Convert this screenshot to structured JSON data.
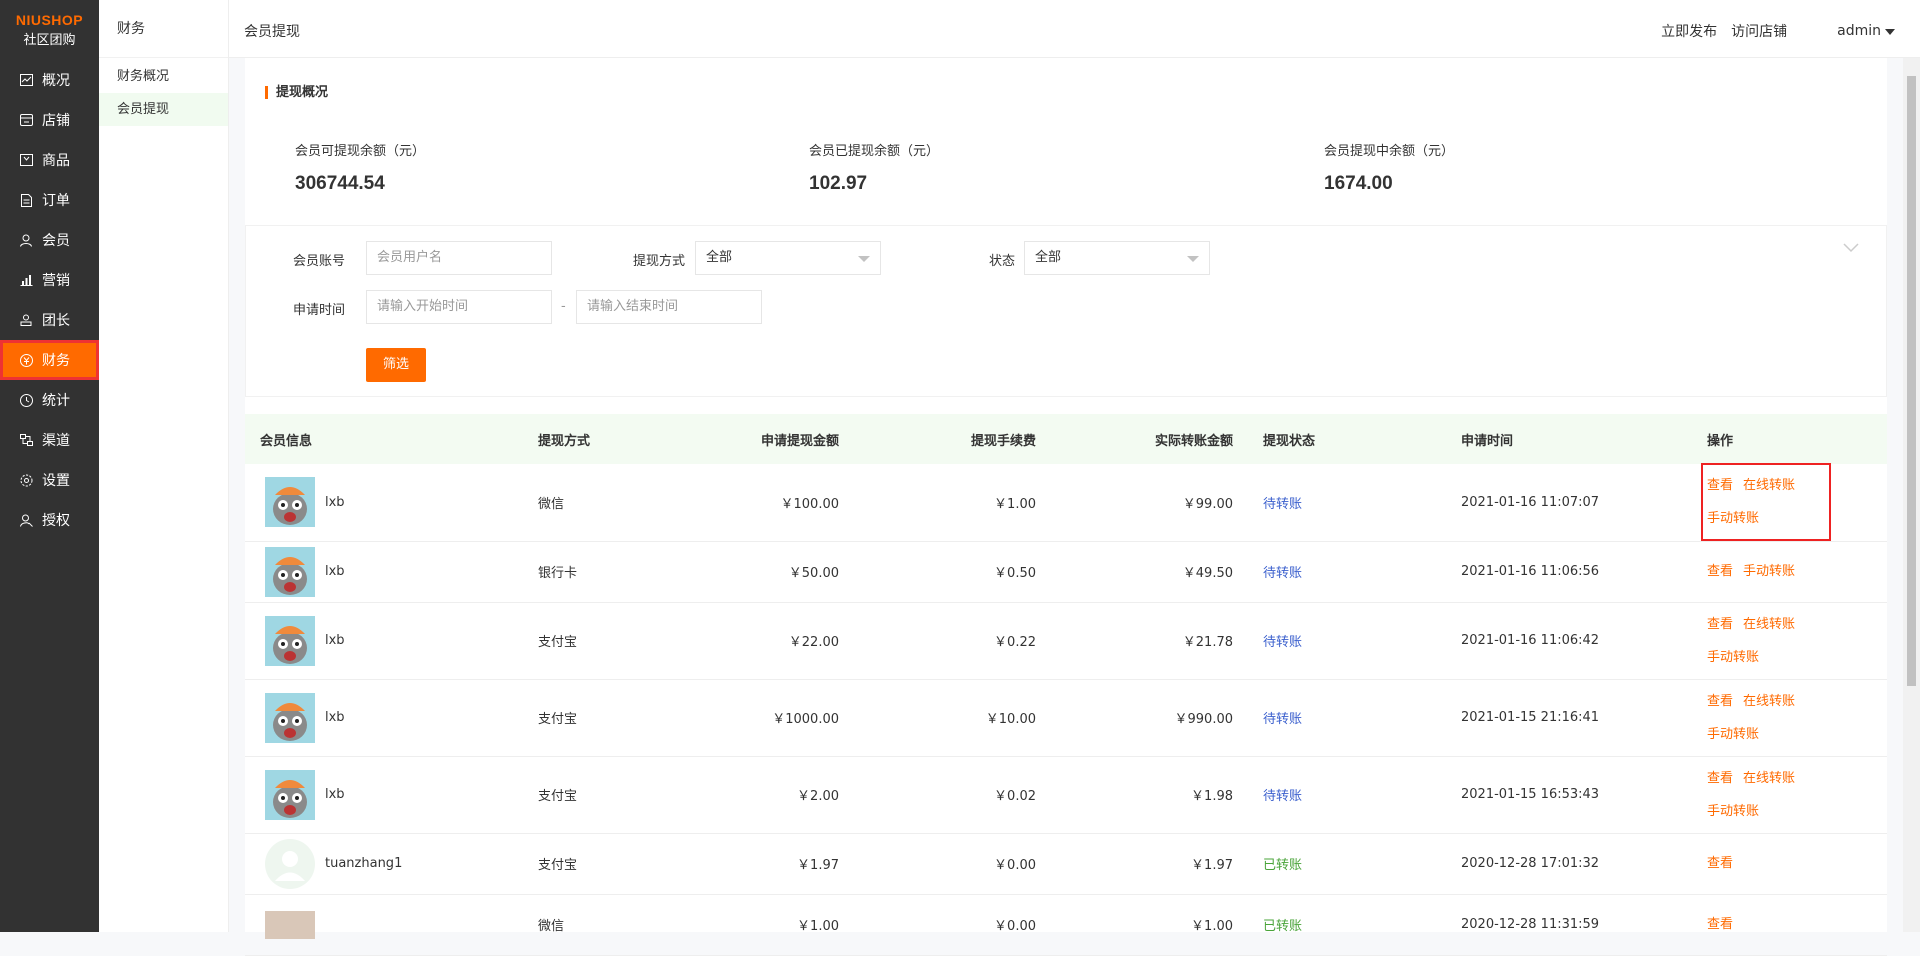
{
  "logo": {
    "line1": "NIUSHOP",
    "line2": "社区团购"
  },
  "sidebar": {
    "items": [
      {
        "label": "概况",
        "icon": "chart-icon"
      },
      {
        "label": "店铺",
        "icon": "store-icon"
      },
      {
        "label": "商品",
        "icon": "goods-icon"
      },
      {
        "label": "订单",
        "icon": "order-icon"
      },
      {
        "label": "会员",
        "icon": "user-icon"
      },
      {
        "label": "营销",
        "icon": "bar-chart-icon"
      },
      {
        "label": "团长",
        "icon": "leader-icon"
      },
      {
        "label": "财务",
        "icon": "yuan-icon"
      },
      {
        "label": "统计",
        "icon": "clock-icon"
      },
      {
        "label": "渠道",
        "icon": "channel-icon"
      },
      {
        "label": "设置",
        "icon": "gear-icon"
      },
      {
        "label": "授权",
        "icon": "key-user-icon"
      }
    ],
    "active": "财务"
  },
  "subside": {
    "title": "财务",
    "items": [
      "财务概况",
      "会员提现"
    ],
    "active": "会员提现"
  },
  "topbar": {
    "breadcrumb": "会员提现",
    "publish": "立即发布",
    "visit": "访问店铺",
    "user": "admin"
  },
  "overview": {
    "title": "提现概况",
    "stats": [
      {
        "label": "会员可提现余额（元）",
        "value": "306744.54"
      },
      {
        "label": "会员已提现余额（元）",
        "value": "102.97"
      },
      {
        "label": "会员提现中余额（元）",
        "value": "1674.00"
      }
    ]
  },
  "filter": {
    "account_label": "会员账号",
    "account_placeholder": "会员用户名",
    "method_label": "提现方式",
    "method_value": "全部",
    "status_label": "状态",
    "status_value": "全部",
    "time_label": "申请时间",
    "start_placeholder": "请输入开始时间",
    "dash": "-",
    "end_placeholder": "请输入结束时间",
    "button": "筛选"
  },
  "table": {
    "headers": [
      "会员信息",
      "提现方式",
      "申请提现金额",
      "提现手续费",
      "实际转账金额",
      "提现状态",
      "申请时间",
      "操作"
    ],
    "rows": [
      {
        "name": "lxb",
        "method": "微信",
        "amount": "￥100.00",
        "fee": "￥1.00",
        "actual": "￥99.00",
        "status": "待转账",
        "time": "2021-01-16 11:07:07",
        "ops": [
          "查看",
          "在线转账",
          "手动转账"
        ]
      },
      {
        "name": "lxb",
        "method": "银行卡",
        "amount": "￥50.00",
        "fee": "￥0.50",
        "actual": "￥49.50",
        "status": "待转账",
        "time": "2021-01-16 11:06:56",
        "ops": [
          "查看",
          "手动转账"
        ]
      },
      {
        "name": "lxb",
        "method": "支付宝",
        "amount": "￥22.00",
        "fee": "￥0.22",
        "actual": "￥21.78",
        "status": "待转账",
        "time": "2021-01-16 11:06:42",
        "ops": [
          "查看",
          "在线转账",
          "手动转账"
        ]
      },
      {
        "name": "lxb",
        "method": "支付宝",
        "amount": "￥1000.00",
        "fee": "￥10.00",
        "actual": "￥990.00",
        "status": "待转账",
        "time": "2021-01-15 21:16:41",
        "ops": [
          "查看",
          "在线转账",
          "手动转账"
        ]
      },
      {
        "name": "lxb",
        "method": "支付宝",
        "amount": "￥2.00",
        "fee": "￥0.02",
        "actual": "￥1.98",
        "status": "待转账",
        "time": "2021-01-15 16:53:43",
        "ops": [
          "查看",
          "在线转账",
          "手动转账"
        ]
      },
      {
        "name": "tuanzhang1",
        "method": "支付宝",
        "amount": "￥1.97",
        "fee": "￥0.00",
        "actual": "￥1.97",
        "status": "已转账",
        "time": "2020-12-28 17:01:32",
        "ops": [
          "查看"
        ]
      },
      {
        "name": "",
        "method": "微信",
        "amount": "￥1.00",
        "fee": "￥0.00",
        "actual": "￥1.00",
        "status": "已转账",
        "time": "2020-12-28 11:31:59",
        "ops": [
          "查看"
        ]
      }
    ]
  }
}
